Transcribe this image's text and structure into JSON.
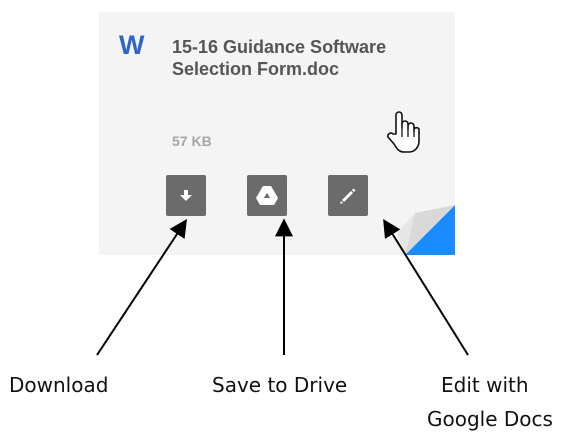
{
  "file": {
    "app_icon_letter": "W",
    "name": "15-16 Guidance Software Selection Form.doc",
    "size": "57 KB"
  },
  "actions": [
    {
      "icon": "download-icon"
    },
    {
      "icon": "google-drive-icon"
    },
    {
      "icon": "pencil-icon"
    }
  ],
  "callouts": {
    "download": "Download",
    "save_to_drive": "Save to Drive",
    "edit_line1": "Edit with",
    "edit_line2": "Google Docs"
  },
  "colors": {
    "card_bg": "#f4f4f4",
    "word_blue": "#2f64c8",
    "button_bg": "#6b6b6b",
    "corner_accent": "#1a8cff"
  }
}
